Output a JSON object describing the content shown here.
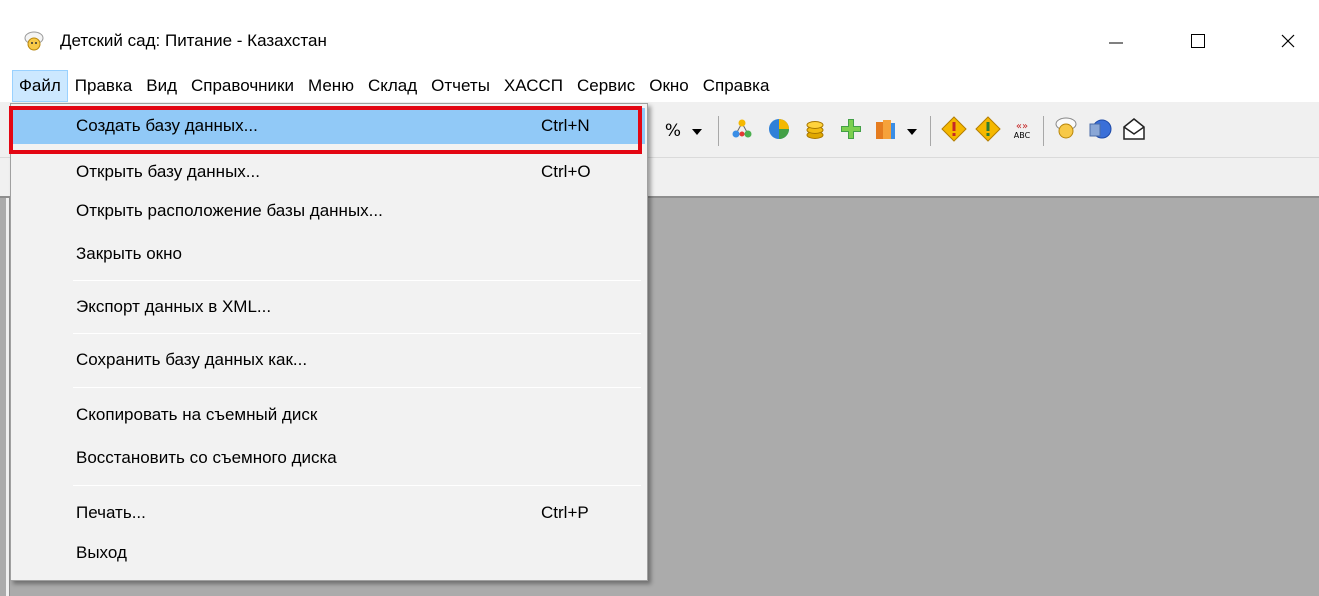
{
  "window": {
    "title": "Детский сад: Питание - Казахстан",
    "controls": {
      "minimize": "minimize-icon",
      "maximize": "maximize-icon",
      "close": "close-icon"
    }
  },
  "menubar": [
    {
      "label": "Файл"
    },
    {
      "label": "Правка"
    },
    {
      "label": "Вид"
    },
    {
      "label": "Справочники"
    },
    {
      "label": "Меню"
    },
    {
      "label": "Склад"
    },
    {
      "label": "Отчеты"
    },
    {
      "label": "ХАССП"
    },
    {
      "label": "Сервис"
    },
    {
      "label": "Окно"
    },
    {
      "label": "Справка"
    }
  ],
  "toolbar": {
    "percent_label": "%",
    "icons": [
      "percent-icon",
      "dropdown-arrow-icon",
      "hierarchy-icon",
      "pie-chart-icon",
      "coins-icon",
      "green-plus-icon",
      "books-icon",
      "dropdown-arrow-icon",
      "warning-diamond-icon",
      "warning-diamond-icon",
      "spellcheck-abc-icon",
      "chef-icon",
      "help-globe-icon",
      "mail-icon"
    ],
    "abc_label": "ABC"
  },
  "file_menu": {
    "items": [
      {
        "label": "Создать базу данных...",
        "shortcut": "Ctrl+N",
        "highlighted": true
      },
      {
        "label": "Открыть базу данных...",
        "shortcut": "Ctrl+O"
      },
      {
        "label": "Открыть расположение базы данных...",
        "shortcut": ""
      },
      {
        "label": "Закрыть окно",
        "shortcut": ""
      },
      {
        "label": "Экспорт данных в XML...",
        "shortcut": ""
      },
      {
        "label": "Сохранить базу данных как...",
        "shortcut": ""
      },
      {
        "label": "Скопировать на съемный диск",
        "shortcut": ""
      },
      {
        "label": "Восстановить со съемного диска",
        "shortcut": ""
      },
      {
        "label": "Печать...",
        "shortcut": "Ctrl+P"
      },
      {
        "label": "Выход",
        "shortcut": ""
      }
    ]
  },
  "colors": {
    "highlight": "#91c9f7",
    "annotation_box": "#e30613",
    "workspace": "#ababab"
  }
}
